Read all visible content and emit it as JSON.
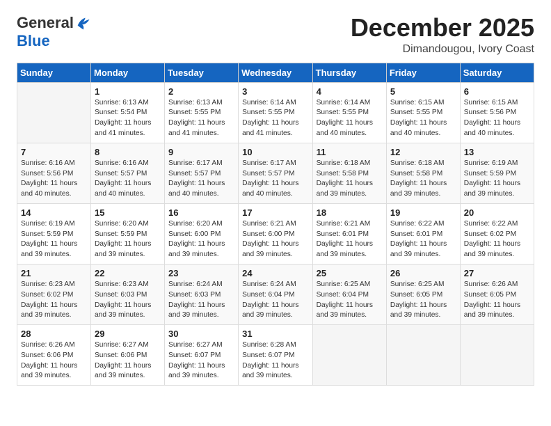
{
  "header": {
    "logo": {
      "general": "General",
      "blue": "Blue"
    },
    "title": "December 2025",
    "subtitle": "Dimandougou, Ivory Coast"
  },
  "calendar": {
    "weekdays": [
      "Sunday",
      "Monday",
      "Tuesday",
      "Wednesday",
      "Thursday",
      "Friday",
      "Saturday"
    ],
    "weeks": [
      [
        {
          "day": "",
          "info": ""
        },
        {
          "day": "1",
          "info": "Sunrise: 6:13 AM\nSunset: 5:54 PM\nDaylight: 11 hours\nand 41 minutes."
        },
        {
          "day": "2",
          "info": "Sunrise: 6:13 AM\nSunset: 5:55 PM\nDaylight: 11 hours\nand 41 minutes."
        },
        {
          "day": "3",
          "info": "Sunrise: 6:14 AM\nSunset: 5:55 PM\nDaylight: 11 hours\nand 41 minutes."
        },
        {
          "day": "4",
          "info": "Sunrise: 6:14 AM\nSunset: 5:55 PM\nDaylight: 11 hours\nand 40 minutes."
        },
        {
          "day": "5",
          "info": "Sunrise: 6:15 AM\nSunset: 5:55 PM\nDaylight: 11 hours\nand 40 minutes."
        },
        {
          "day": "6",
          "info": "Sunrise: 6:15 AM\nSunset: 5:56 PM\nDaylight: 11 hours\nand 40 minutes."
        }
      ],
      [
        {
          "day": "7",
          "info": "Sunrise: 6:16 AM\nSunset: 5:56 PM\nDaylight: 11 hours\nand 40 minutes."
        },
        {
          "day": "8",
          "info": "Sunrise: 6:16 AM\nSunset: 5:57 PM\nDaylight: 11 hours\nand 40 minutes."
        },
        {
          "day": "9",
          "info": "Sunrise: 6:17 AM\nSunset: 5:57 PM\nDaylight: 11 hours\nand 40 minutes."
        },
        {
          "day": "10",
          "info": "Sunrise: 6:17 AM\nSunset: 5:57 PM\nDaylight: 11 hours\nand 40 minutes."
        },
        {
          "day": "11",
          "info": "Sunrise: 6:18 AM\nSunset: 5:58 PM\nDaylight: 11 hours\nand 39 minutes."
        },
        {
          "day": "12",
          "info": "Sunrise: 6:18 AM\nSunset: 5:58 PM\nDaylight: 11 hours\nand 39 minutes."
        },
        {
          "day": "13",
          "info": "Sunrise: 6:19 AM\nSunset: 5:59 PM\nDaylight: 11 hours\nand 39 minutes."
        }
      ],
      [
        {
          "day": "14",
          "info": "Sunrise: 6:19 AM\nSunset: 5:59 PM\nDaylight: 11 hours\nand 39 minutes."
        },
        {
          "day": "15",
          "info": "Sunrise: 6:20 AM\nSunset: 5:59 PM\nDaylight: 11 hours\nand 39 minutes."
        },
        {
          "day": "16",
          "info": "Sunrise: 6:20 AM\nSunset: 6:00 PM\nDaylight: 11 hours\nand 39 minutes."
        },
        {
          "day": "17",
          "info": "Sunrise: 6:21 AM\nSunset: 6:00 PM\nDaylight: 11 hours\nand 39 minutes."
        },
        {
          "day": "18",
          "info": "Sunrise: 6:21 AM\nSunset: 6:01 PM\nDaylight: 11 hours\nand 39 minutes."
        },
        {
          "day": "19",
          "info": "Sunrise: 6:22 AM\nSunset: 6:01 PM\nDaylight: 11 hours\nand 39 minutes."
        },
        {
          "day": "20",
          "info": "Sunrise: 6:22 AM\nSunset: 6:02 PM\nDaylight: 11 hours\nand 39 minutes."
        }
      ],
      [
        {
          "day": "21",
          "info": "Sunrise: 6:23 AM\nSunset: 6:02 PM\nDaylight: 11 hours\nand 39 minutes."
        },
        {
          "day": "22",
          "info": "Sunrise: 6:23 AM\nSunset: 6:03 PM\nDaylight: 11 hours\nand 39 minutes."
        },
        {
          "day": "23",
          "info": "Sunrise: 6:24 AM\nSunset: 6:03 PM\nDaylight: 11 hours\nand 39 minutes."
        },
        {
          "day": "24",
          "info": "Sunrise: 6:24 AM\nSunset: 6:04 PM\nDaylight: 11 hours\nand 39 minutes."
        },
        {
          "day": "25",
          "info": "Sunrise: 6:25 AM\nSunset: 6:04 PM\nDaylight: 11 hours\nand 39 minutes."
        },
        {
          "day": "26",
          "info": "Sunrise: 6:25 AM\nSunset: 6:05 PM\nDaylight: 11 hours\nand 39 minutes."
        },
        {
          "day": "27",
          "info": "Sunrise: 6:26 AM\nSunset: 6:05 PM\nDaylight: 11 hours\nand 39 minutes."
        }
      ],
      [
        {
          "day": "28",
          "info": "Sunrise: 6:26 AM\nSunset: 6:06 PM\nDaylight: 11 hours\nand 39 minutes."
        },
        {
          "day": "29",
          "info": "Sunrise: 6:27 AM\nSunset: 6:06 PM\nDaylight: 11 hours\nand 39 minutes."
        },
        {
          "day": "30",
          "info": "Sunrise: 6:27 AM\nSunset: 6:07 PM\nDaylight: 11 hours\nand 39 minutes."
        },
        {
          "day": "31",
          "info": "Sunrise: 6:28 AM\nSunset: 6:07 PM\nDaylight: 11 hours\nand 39 minutes."
        },
        {
          "day": "",
          "info": ""
        },
        {
          "day": "",
          "info": ""
        },
        {
          "day": "",
          "info": ""
        }
      ]
    ]
  }
}
